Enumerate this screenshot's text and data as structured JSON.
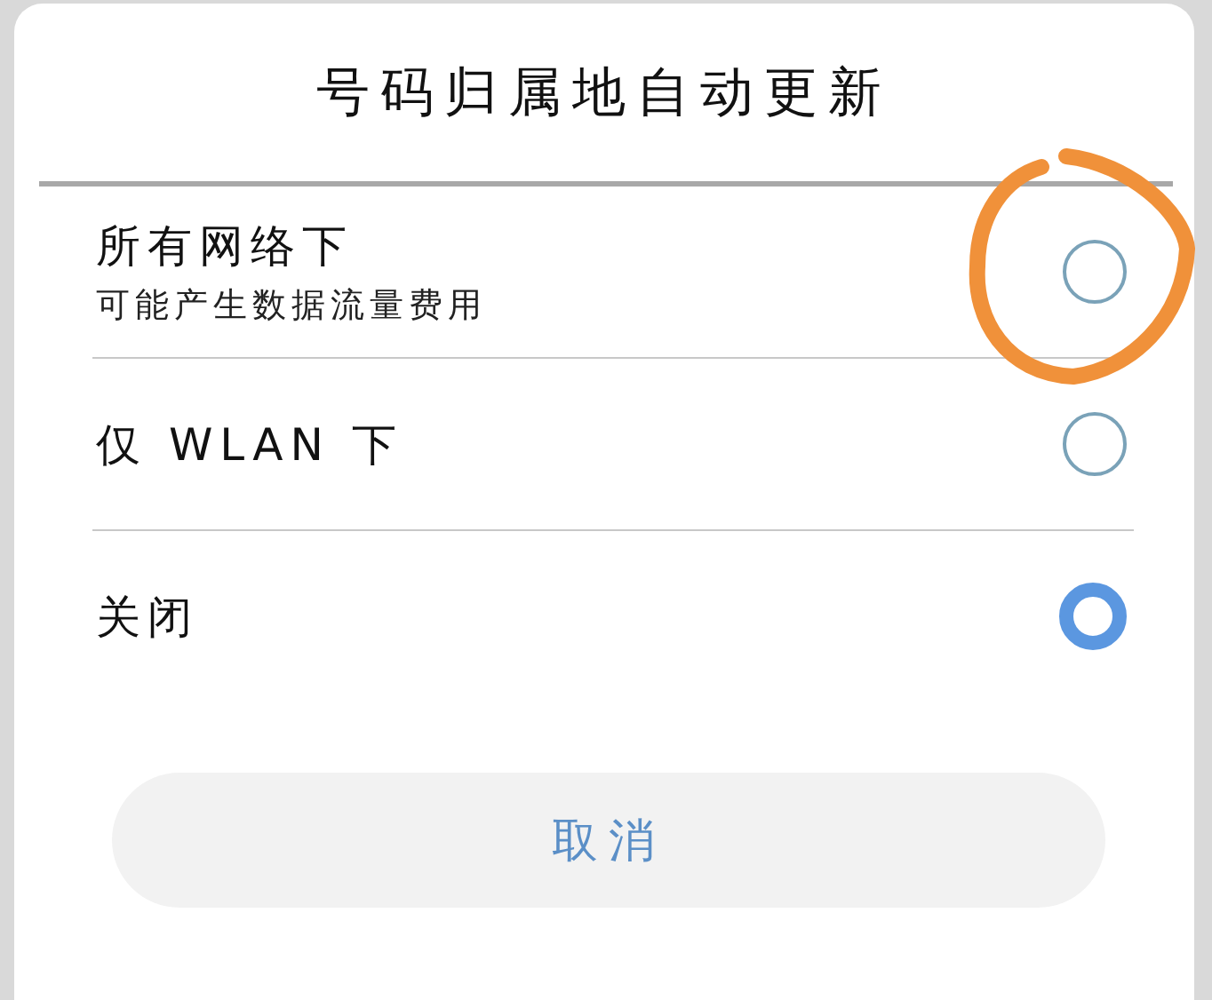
{
  "dialog": {
    "title": "号码归属地自动更新",
    "options": [
      {
        "label": "所有网络下",
        "hint": "可能产生数据流量费用",
        "selected": false
      },
      {
        "label": "仅 WLAN 下",
        "selected": false
      },
      {
        "label": "关闭",
        "selected": true
      }
    ],
    "cancel_button": "取消"
  },
  "annotation": {
    "kind": "hand-drawn-circle",
    "color": "#f0913a"
  }
}
